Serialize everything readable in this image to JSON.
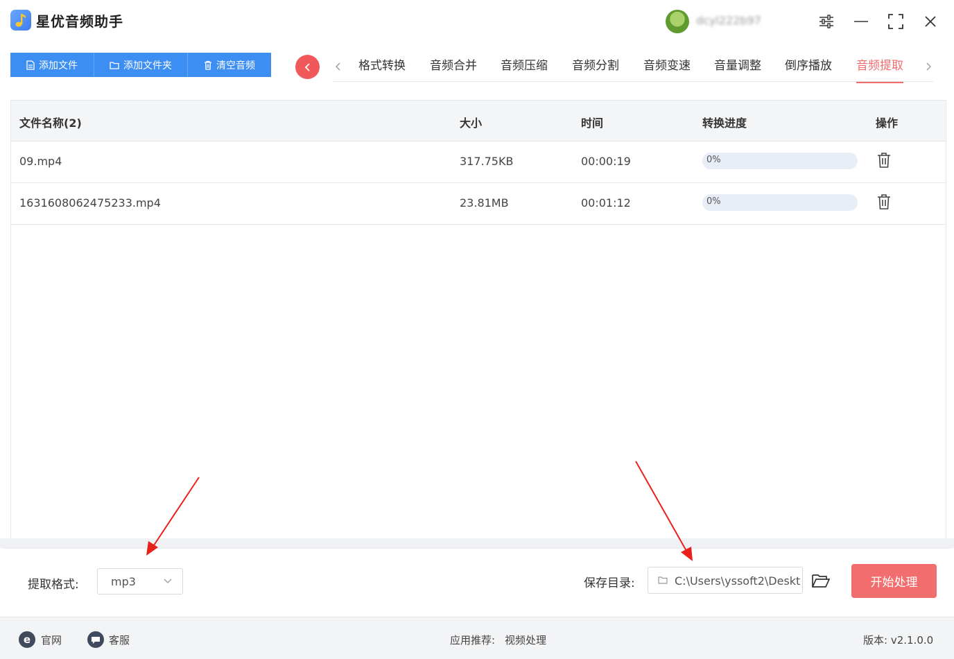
{
  "app": {
    "title": "星优音频助手"
  },
  "user": {
    "name": "dcyl222b97"
  },
  "titlebar": {
    "icons": [
      "settings-sliders-icon",
      "minimize-icon",
      "maximize-icon",
      "close-icon"
    ]
  },
  "toolbar": {
    "buttons": [
      {
        "label": "添加文件",
        "icon": "file-icon"
      },
      {
        "label": "添加文件夹",
        "icon": "folder-icon"
      },
      {
        "label": "清空音频",
        "icon": "trash-icon"
      }
    ],
    "accent": "#3d8ef2"
  },
  "tabs": [
    {
      "label": "格式转换"
    },
    {
      "label": "音频合并"
    },
    {
      "label": "音频压缩"
    },
    {
      "label": "音频分割"
    },
    {
      "label": "音频变速"
    },
    {
      "label": "音量调整"
    },
    {
      "label": "倒序播放"
    },
    {
      "label": "音频提取",
      "active": true
    }
  ],
  "table": {
    "headers": {
      "name": "文件名称(2)",
      "size": "大小",
      "time": "时间",
      "progress": "转换进度",
      "action": "操作"
    },
    "rows": [
      {
        "name": "09.mp4",
        "size": "317.75KB",
        "time": "00:00:19",
        "progress_label": "0%",
        "progress": 0
      },
      {
        "name": "1631608062475233.mp4",
        "size": "23.81MB",
        "time": "00:01:12",
        "progress_label": "0%",
        "progress": 0
      }
    ]
  },
  "settings": {
    "format_label": "提取格式:",
    "format_value": "mp3",
    "save_label": "保存目录:",
    "save_path": "C:\\Users\\yssoft2\\Deskt",
    "start_button": "开始处理",
    "start_color": "#f16d6e"
  },
  "footer": {
    "website": "官网",
    "service": "客服",
    "recommend_label": "应用推荐:",
    "recommend_link": "视频处理",
    "version": "版本:  v2.1.0.0"
  }
}
